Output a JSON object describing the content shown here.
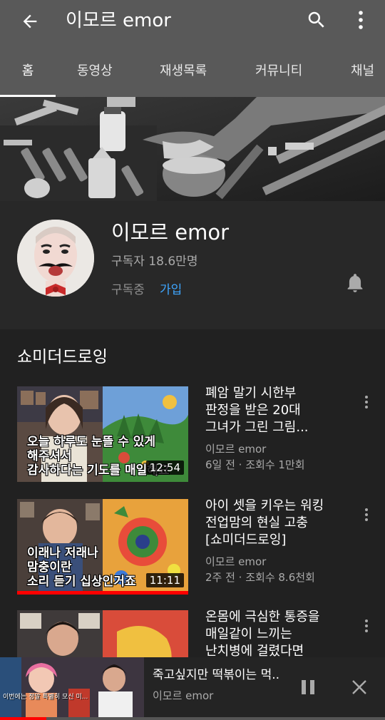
{
  "appbar": {
    "title": "이모르 emor",
    "icons": [
      "back-arrow-icon",
      "search-icon",
      "more-vert-icon"
    ]
  },
  "tabs": [
    {
      "label": "홈",
      "active": true
    },
    {
      "label": "동영상",
      "active": false
    },
    {
      "label": "재생목록",
      "active": false
    },
    {
      "label": "커뮤니티",
      "active": false
    },
    {
      "label": "채널",
      "active": false
    }
  ],
  "channel": {
    "name": "이모르 emor",
    "subscribers": "구독자 18.6만명",
    "subscribed_label": "구독중",
    "join_label": "가입",
    "bell_icon": "bell-icon"
  },
  "shelf": {
    "title": "쇼미더드로잉",
    "videos": [
      {
        "title_lines": [
          "폐암 말기 시한부",
          "판정을 받은 20대",
          "그녀가 그린 그림..."
        ],
        "channel": "이모르 emor",
        "meta": "6일 전 · 조회수 1만회",
        "duration": "12:54",
        "thumb_text": "오늘 하루도 눈뜰 수 있게\n해주셔서\n감사하다는 기도를 매일해요",
        "progress": 0
      },
      {
        "title_lines": [
          "아이 셋을 키우는 워킹",
          "전업맘의 현실 고충",
          "[쇼미더드로잉]"
        ],
        "channel": "이모르 emor",
        "meta": "2주 전 · 조회수 8.6천회",
        "duration": "11:11",
        "thumb_text": "이래나 저래나\n맘충이란\n소리 듣기 십상인거죠",
        "progress": 1.0
      },
      {
        "title_lines": [
          "온몸에 극심한 통증을",
          "매일같이 느끼는",
          "난치병에 걸렸다면"
        ],
        "channel": "이모르 emor",
        "meta": "",
        "duration": "",
        "thumb_text": "",
        "progress": 0
      }
    ]
  },
  "miniplayer": {
    "title": "죽고싶지만 떡볶이는 먹..",
    "channel": "이모르 emor",
    "caption": "이번에는 정말 특별히 모신 미...",
    "progress": 0.12
  },
  "colors": {
    "header_bg": "#595959",
    "page_bg": "#212121",
    "channel_bg": "#282828",
    "accent_blue": "#3ea6ff",
    "progress_red": "#ff0000",
    "secondary_text": "#aaaaaa"
  }
}
